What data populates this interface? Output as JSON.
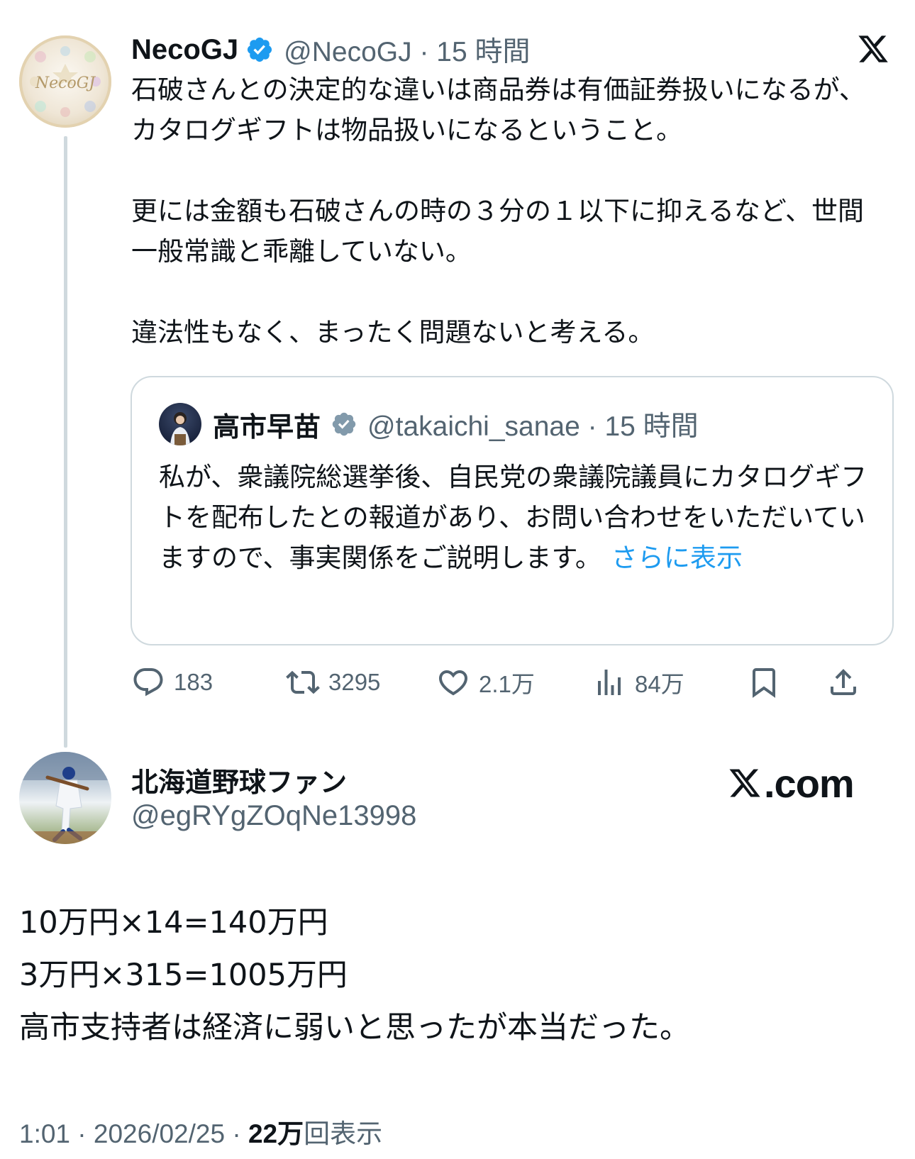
{
  "quoted_post": {
    "author": {
      "display_name": "NecoGJ",
      "handle_time": "@NecoGJ · 15 時間",
      "avatar_text": "NecoGJ",
      "verified_color": "#1d9bf0"
    },
    "text": "石破さんとの決定的な違いは商品券は有価証券扱いになるが、カタログギフトは物品扱いになるということ。\n\n更には金額も石破さんの時の３分の１以下に抑えるなど、世間一般常識と乖離していない。\n\n違法性もなく、まったく問題ないと考える。",
    "quote": {
      "display_name": "高市早苗",
      "handle_time": "@takaichi_sanae · 15 時間",
      "text": "私が、衆議院総選挙後、自民党の衆議院議員にカタログギフトを配布したとの報道があり、お問い合わせをいただいていますので、事実関係をご説明します。",
      "show_more": "さらに表示",
      "verified_color": "#829aab"
    },
    "metrics": {
      "replies": "183",
      "reposts": "3295",
      "likes": "2.1万",
      "views": "84万"
    }
  },
  "post": {
    "author": {
      "display_name": "北海道野球ファン",
      "handle": "@egRYgZOqNe13998"
    },
    "text": "10万円×14=140万円\n3万円×315=1005万円\n高市支持者は経済に弱いと思ったが本当だった。",
    "time_date": "1:01 · 2026/02/25 · ",
    "views_count": "22万",
    "views_label": "回表示"
  },
  "watermark": {
    "text": ".com"
  },
  "colors": {
    "text": "#0f1419",
    "secondary": "#536471",
    "accent": "#1d9bf0",
    "border": "#cfd9de"
  },
  "icons": [
    "x-logo-icon",
    "verified-badge-icon",
    "reply-icon",
    "repost-icon",
    "like-icon",
    "views-icon",
    "bookmark-icon",
    "share-icon"
  ]
}
